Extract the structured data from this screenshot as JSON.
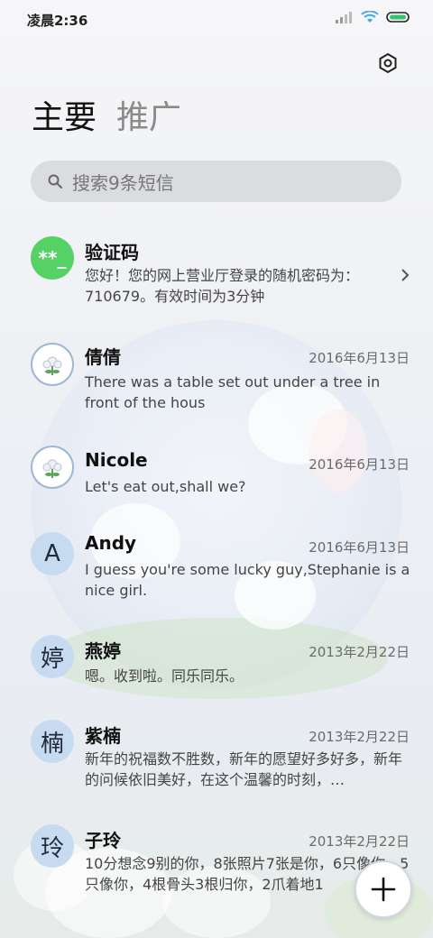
{
  "status_bar": {
    "time": "凌晨2:36"
  },
  "tabs": [
    {
      "label": "主要"
    },
    {
      "label": "推广"
    }
  ],
  "search": {
    "placeholder": "搜索9条短信"
  },
  "messages": [
    {
      "name": "验证码",
      "avatar_text": "**_",
      "avatar_style": "green",
      "date": "",
      "preview": "您好！您的网上营业厅登录的随机密码为：710679。有效时间为3分钟"
    },
    {
      "name": "倩倩",
      "avatar_text": "",
      "avatar_style": "flower",
      "date": "2016年6月13日",
      "preview": "There was a table set out under a tree in front of the hous"
    },
    {
      "name": "Nicole",
      "avatar_text": "",
      "avatar_style": "flower",
      "date": "2016年6月13日",
      "preview": "Let's eat out,shall we?"
    },
    {
      "name": "Andy",
      "avatar_text": "A",
      "avatar_style": "letter",
      "date": "2016年6月13日",
      "preview": "I guess you're some lucky guy,Stephanie is a nice girl."
    },
    {
      "name": "燕婷",
      "avatar_text": "婷",
      "avatar_style": "letter",
      "date": "2013年2月22日",
      "preview": "嗯。收到啦。同乐同乐。"
    },
    {
      "name": "紫楠",
      "avatar_text": "楠",
      "avatar_style": "letter",
      "date": "2013年2月22日",
      "preview": "新年的祝福数不胜数，新年的愿望好多好多，新年的问候依旧美好，在这个温馨的时刻，…"
    },
    {
      "name": "子玲",
      "avatar_text": "玲",
      "avatar_style": "letter",
      "date": "2013年2月22日",
      "preview": "10分想念9别的你，8张照片7张是你，6只像你，5只像你，4根骨头3根归你，2爪着地1"
    }
  ],
  "colors": {
    "accent_green": "#56d165",
    "letter_avatar_bg": "#c7dbf0"
  },
  "icons": {
    "settings": "gear-icon",
    "search": "search-icon",
    "compose": "plus-icon",
    "chevron": "chevron-right-icon"
  }
}
